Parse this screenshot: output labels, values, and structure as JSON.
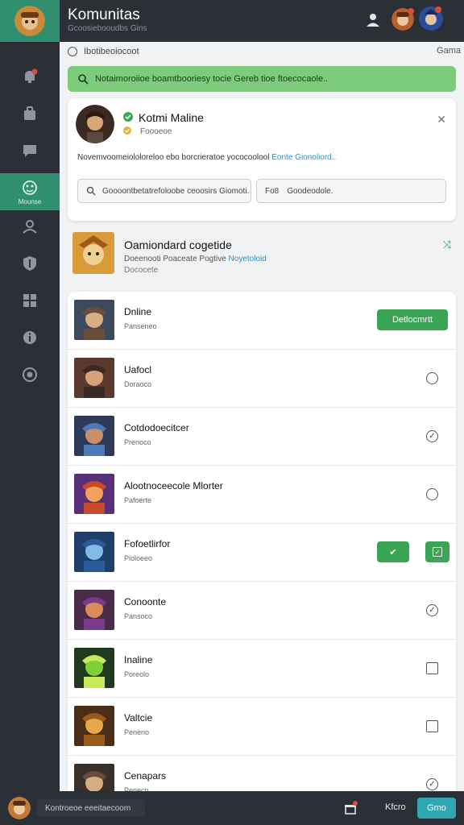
{
  "header": {
    "title": "Komunitas",
    "subtitle": "Gcoosiebooudbs Gins"
  },
  "sidebar": {
    "active_label": "Mounse",
    "items": [
      "notification-bell",
      "briefcase",
      "chat",
      "groups",
      "profile",
      "shield",
      "grid",
      "info",
      "settings"
    ]
  },
  "search": {
    "text": "Ibotibeoiocoot",
    "right_label": "Gama"
  },
  "notice": {
    "text": "Notaimoroiioe boamtbooriesy tocie Gereb tioe ftoecocaole.."
  },
  "profile_card": {
    "name": "Kotmi Maline",
    "subtitle": "Foooeoe",
    "description": "Novemvoomeiololoreloo ebo borcrieratoe yococoolool",
    "description_link": "Eonte Gionoliord..",
    "field1": "Goooontbetatrefoloobe ceoosirs Giomoti.",
    "field2_prefix": "Fo8",
    "field2": "Goodeodole."
  },
  "featured": {
    "title": "Oamiondard cogetide",
    "sub_prefix": "Doeenooti Poaceate Pogtive",
    "sub_link": "Noyetoloid",
    "sub2": "Dococete"
  },
  "list": [
    {
      "name": "Dnline",
      "sub": "Panseneo",
      "action": "button",
      "button_label": "Detlocmrtt"
    },
    {
      "name": "Uafocl",
      "sub": "Doraoco",
      "action": "circle"
    },
    {
      "name": "Cotdodoecitcer",
      "sub": "Prenoco",
      "action": "check-circle"
    },
    {
      "name": "Alootnoceecole Mlorter",
      "sub": "Pafoerte",
      "action": "circle"
    },
    {
      "name": "Fofoetlirfor",
      "sub": "Pioloeeo",
      "action": "green-pair"
    },
    {
      "name": "Conoonte",
      "sub": "Pansoco",
      "action": "check-circle"
    },
    {
      "name": "Inaline",
      "sub": "Poreolo",
      "action": "square"
    },
    {
      "name": "Valtcie",
      "sub": "Peneno",
      "action": "square"
    },
    {
      "name": "Cenapars",
      "sub": "Peneco",
      "action": "check-circle"
    }
  ],
  "footer": {
    "input_text": "Kontroeoe eeeitaecoom",
    "text": "Kfcro",
    "button_label": "Gmo"
  },
  "colors": {
    "accent_green": "#2f8f6e",
    "button_green": "#3aa655",
    "notice_green": "#7dcc7b",
    "dark_bg": "#2b2f36",
    "link_blue": "#2e8fc3",
    "teal_button": "#2fa8b3"
  }
}
